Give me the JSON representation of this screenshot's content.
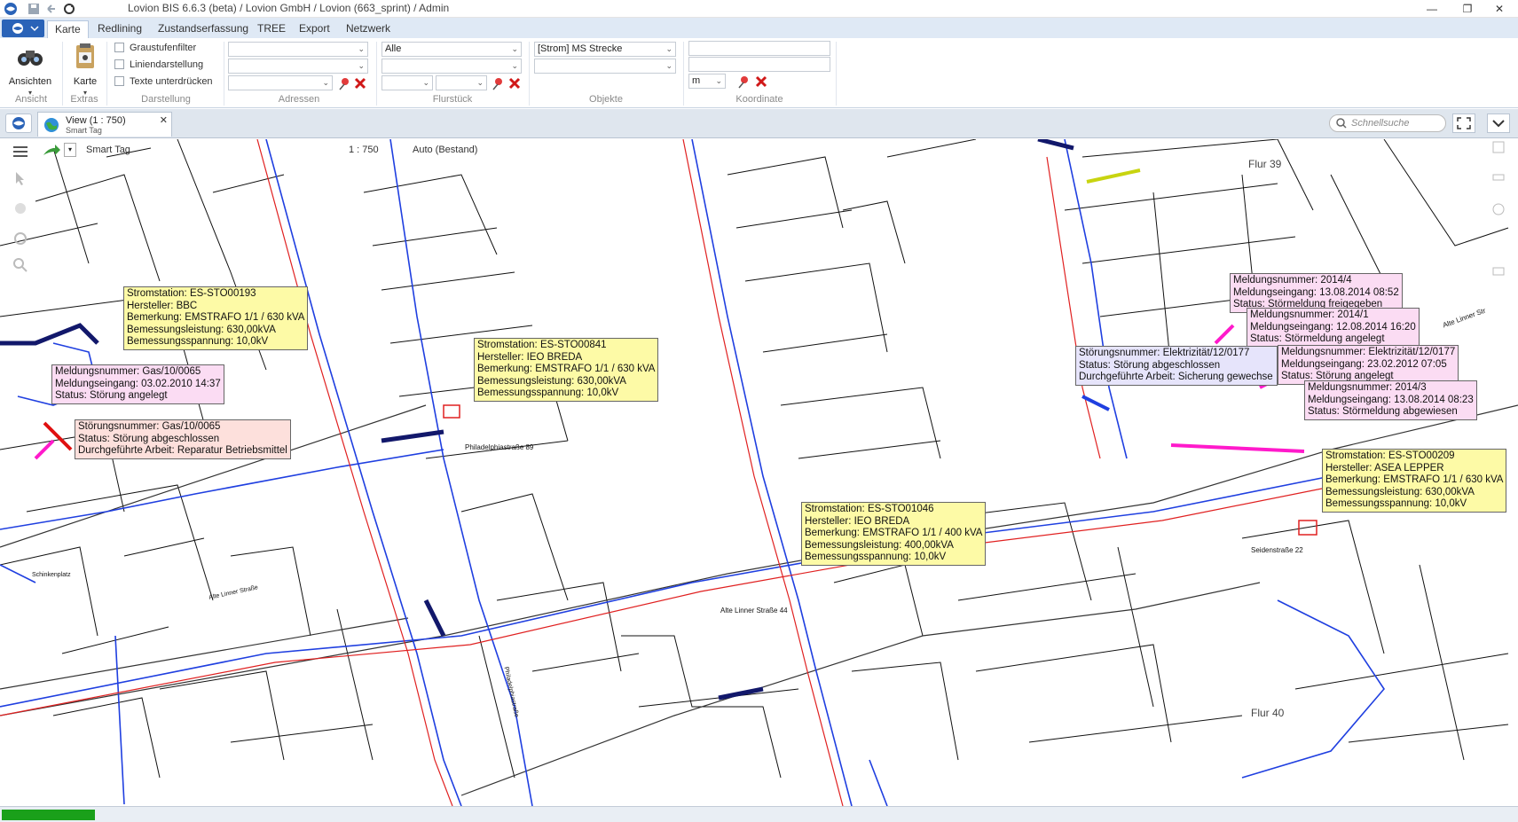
{
  "window": {
    "title": "Lovion BIS 6.6.3 (beta) / Lovion GmbH / Lovion (663_sprint) / Admin",
    "minimize": "—",
    "maximize": "❐",
    "close": "✕"
  },
  "ribbon": {
    "tabs": [
      "Karte",
      "Redlining",
      "Zustandserfassung",
      "TREE",
      "Export",
      "Netzwerk"
    ],
    "active_tab": "Karte",
    "groups": {
      "ansicht": {
        "label": "Ansicht",
        "button": "Ansichten"
      },
      "extras": {
        "label": "Extras",
        "button": "Karte"
      },
      "darstellung": {
        "label": "Darstellung",
        "checkboxes": [
          "Graustufenfilter",
          "Liniendarstellung",
          "Texte unterdrücken"
        ]
      },
      "adressen": {
        "label": "Adressen"
      },
      "flurstueck": {
        "label": "Flurstück",
        "combo1": "Alle"
      },
      "objekte": {
        "label": "Objekte",
        "combo1": "[Strom] MS Strecke"
      },
      "koordinate": {
        "label": "Koordinate",
        "unit": "m"
      }
    }
  },
  "document_tab": {
    "title": "View (1 : 750)",
    "subtitle": "Smart Tag",
    "close": "✕",
    "search_placeholder": "Schnellsuche"
  },
  "map_toolbar": {
    "smart_tag": "Smart Tag",
    "scale": "1 : 750",
    "mode": "Auto (Bestand)"
  },
  "map_labels": {
    "flur39": "Flur 39",
    "flur40": "Flur 40",
    "philadelphia": "Philadelphiastraße 89",
    "alte_linner_44": "Alte Linner Straße 44",
    "alte_linner": "Alte Linner Straße",
    "alte_linner_right": "Alte Linner Str",
    "seidenstrasse": "Seidenstraße 22",
    "schinkenplatz": "Schinkenplatz",
    "philadelphiastrasse_vert": "Philadelphiastraße"
  },
  "callouts": [
    {
      "id": "sto00193",
      "color": "yellow",
      "lines": [
        "Stromstation: ES-STO00193",
        "Hersteller: BBC",
        "Bemerkung: EMSTRAFO 1/1 / 630 kVA",
        "Bemessungsleistung: 630,00kVA",
        "Bemessungsspannung: 10,0kV"
      ]
    },
    {
      "id": "gas0065a",
      "color": "pink",
      "lines": [
        "Meldungsnummer: Gas/10/0065",
        "Meldungseingang: 03.02.2010 14:37",
        "Status: Störung angelegt"
      ]
    },
    {
      "id": "gas0065b",
      "color": "salmon",
      "lines": [
        "Störungsnummer: Gas/10/0065",
        "Status: Störung abgeschlossen",
        "Durchgeführte Arbeit: Reparatur Betriebsmittel"
      ]
    },
    {
      "id": "sto00841",
      "color": "yellow",
      "lines": [
        "Stromstation: ES-STO00841",
        "Hersteller: IEO BREDA",
        "Bemerkung: EMSTRAFO 1/1 / 630 kVA",
        "Bemessungsleistung: 630,00kVA",
        "Bemessungsspannung: 10,0kV"
      ]
    },
    {
      "id": "sto01046",
      "color": "yellow",
      "lines": [
        "Stromstation: ES-STO01046",
        "Hersteller: IEO BREDA",
        "Bemerkung: EMSTRAFO 1/1 / 400 kVA",
        "Bemessungsleistung: 400,00kVA",
        "Bemessungsspannung: 10,0kV"
      ]
    },
    {
      "id": "m2014_4",
      "color": "pink",
      "lines": [
        "Meldungsnummer: 2014/4",
        "Meldungseingang: 13.08.2014 08:52",
        "Status: Störmeldung freigegeben"
      ]
    },
    {
      "id": "m2014_1",
      "color": "pink",
      "lines": [
        "Meldungsnummer: 2014/1",
        "Meldungseingang: 12.08.2014 16:20",
        "Status: Störmeldung angelegt"
      ]
    },
    {
      "id": "el0177a",
      "color": "lav",
      "lines": [
        "Störungsnummer: Elektrizität/12/0177",
        "Status: Störung abgeschlossen",
        "Durchgeführte Arbeit: Sicherung gewechse"
      ]
    },
    {
      "id": "el0177b",
      "color": "pink",
      "lines": [
        "Meldungsnummer: Elektrizität/12/0177",
        "Meldungseingang: 23.02.2012 07:05",
        "Status: Störung angelegt"
      ]
    },
    {
      "id": "m2014_3",
      "color": "pink",
      "lines": [
        "Meldungsnummer: 2014/3",
        "Meldungseingang: 13.08.2014 08:23",
        "Status: Störmeldung abgewiesen"
      ]
    },
    {
      "id": "sto00209",
      "color": "yellow",
      "lines": [
        "Stromstation: ES-STO00209",
        "Hersteller: ASEA LEPPER",
        "Bemerkung: EMSTRAFO 1/1 / 630 kVA",
        "Bemessungsleistung: 630,00kVA",
        "Bemessungsspannung: 10,0kV"
      ]
    }
  ],
  "colors": {
    "ribbon_tabs_bg": "#dfe9f5",
    "callout_yellow": "#fdfaa6",
    "callout_pink": "#fbdcf3",
    "cable_blue": "#1f3fe0",
    "cable_red": "#e02020",
    "fault_magenta": "#ff1acb",
    "progress_green": "#1aa01a"
  },
  "status": {
    "progress": 1.0
  }
}
